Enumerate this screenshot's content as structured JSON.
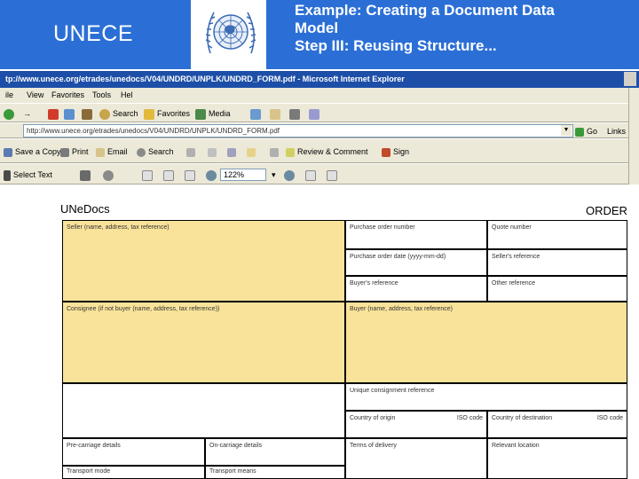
{
  "slide": {
    "org": "UNECE",
    "title_line1": "Example: Creating a Document Data",
    "title_line2": "Model",
    "title_line3": "Step III: Reusing Structure...",
    "logo": "un-emblem-icon"
  },
  "browser": {
    "title": "tp://www.unece.org/etrades/unedocs/V04/UNDRD/UNPLK/UNDRD_FORM.pdf - Microsoft Internet Explorer",
    "menu": [
      "ile",
      "View",
      "Favorites",
      "Tools",
      "Hel"
    ],
    "nav": {
      "search": "Search",
      "favorites": "Favorites",
      "media": "Media"
    },
    "address": "http://www.unece.org/etrades/unedocs/V04/UNDRD/UNPLK/UNDRD_FORM.pdf",
    "go": "Go",
    "links": "Links",
    "pdf_toolbar": {
      "save_copy": "Save a Copy",
      "print": "Print",
      "email": "Email",
      "search": "Search",
      "review": "Review & Comment",
      "sign": "Sign"
    },
    "select_text": "Select Text",
    "zoom": "122%"
  },
  "document": {
    "brand": "UNeDocs",
    "type": "ORDER",
    "fields": {
      "seller": "Seller (name, address, tax reference)",
      "po_number": "Purchase order number",
      "quote_number": "Quote number",
      "po_date": "Purchase order date (yyyy-mm-dd)",
      "seller_ref": "Seller's reference",
      "buyer_ref": "Buyer's reference",
      "other_ref": "Other reference",
      "consignee": "Consignee (if not buyer (name, address, tax reference))",
      "buyer": "Buyer (name, address, tax reference)",
      "consignment_ref": "Unique consignment reference",
      "country_origin": "Country of origin",
      "iso_code_1": "ISO code",
      "country_destination": "Country of destination",
      "iso_code_2": "ISO code",
      "pre_carriage": "Pre-carriage details",
      "on_carriage": "On-carriage details",
      "terms_delivery": "Terms of delivery",
      "relevant_location": "Relevant location",
      "transport_mode": "Transport mode",
      "transport_means": "Transport means"
    }
  },
  "colors": {
    "slide_blue": "#2b6fd6",
    "field_yellow": "#f9e39a",
    "ie_title": "#1d4fa8",
    "chrome": "#ece9d8"
  }
}
